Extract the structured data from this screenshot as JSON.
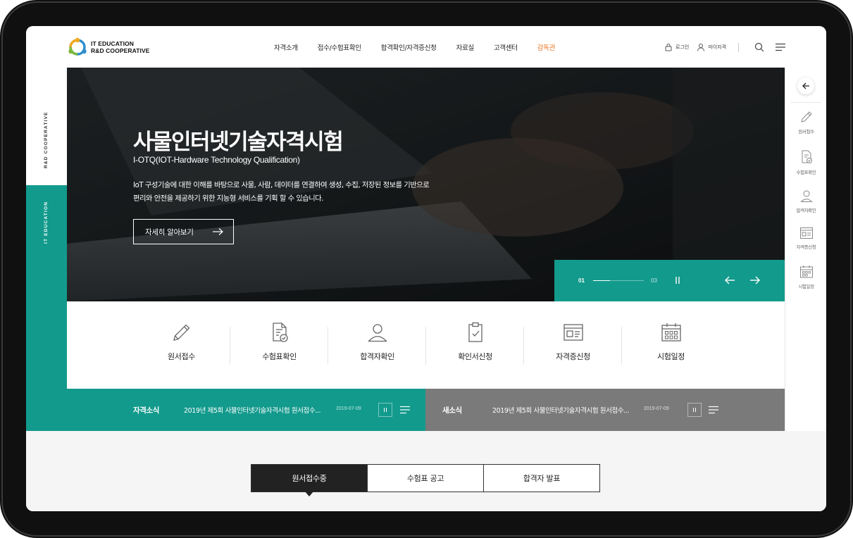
{
  "brand": {
    "line1": "IT EDUCATION",
    "line2": "R&D COOPERATIVE",
    "colors": {
      "teal": "#129a8c",
      "orange": "#e8741e",
      "gray": "#7a7a7a",
      "dark": "#222222"
    }
  },
  "nav": {
    "items": [
      {
        "label": "자격소개",
        "active": false
      },
      {
        "label": "접수/수험표확인",
        "active": false
      },
      {
        "label": "합격확인/자격증신청",
        "active": false
      },
      {
        "label": "자료실",
        "active": false
      },
      {
        "label": "고객센터",
        "active": false
      },
      {
        "label": "감독관",
        "active": true
      }
    ],
    "login": "로그인",
    "mypage": "마이자격",
    "search_icon": "search-icon",
    "menu_icon": "hamburger-menu-icon"
  },
  "rail": {
    "top_label": "R&D COOPERATIVE",
    "bottom_label": "IT EDUCATION"
  },
  "hero": {
    "title": "사물인터넷기술자격시험",
    "subtitle": "I-OTQ(IOT-Hardware Technology Qualification)",
    "desc_line1": "IoT 구성기술에 대한 이해를 바탕으로 사물, 사람, 데이터를 연결하여 생성, 수집, 저장된 정보를 기반으로",
    "desc_line2": "편리와 안전을 제공하기 위한 지능형 서비스를 기획 할 수 있습니다.",
    "button": "자세히 알아보기",
    "slide_current": "01",
    "slide_total": "03",
    "slide_progress": 0.33
  },
  "quick_menu": {
    "items": [
      {
        "label": "원서접수",
        "icon": "pencil-icon"
      },
      {
        "label": "수험표확인",
        "icon": "document-check-icon"
      },
      {
        "label": "합격자확인",
        "icon": "person-icon"
      },
      {
        "label": "자격증신청",
        "icon": "certificate-icon"
      },
      {
        "label": "시험일정",
        "icon": "calendar-icon"
      }
    ]
  },
  "services": [
    {
      "label": "원서접수",
      "icon": "pencil-icon"
    },
    {
      "label": "수험표확인",
      "icon": "document-check-icon"
    },
    {
      "label": "합격자확인",
      "icon": "person-icon"
    },
    {
      "label": "확인서신청",
      "icon": "clipboard-check-icon"
    },
    {
      "label": "자격증신청",
      "icon": "certificate-icon"
    },
    {
      "label": "시험일정",
      "icon": "calendar-icon"
    }
  ],
  "news": {
    "cert": {
      "title": "자격소식",
      "text": "2019년 제5회 사물인터넷기술자격시험 원서접수...",
      "date": "2019-07-09"
    },
    "general": {
      "title": "새소식",
      "text": "2019년 제5회 사물인터넷기술자격시험 원서접수...",
      "date": "2019-07-09"
    }
  },
  "tabs": [
    {
      "label": "원서접수중",
      "active": true
    },
    {
      "label": "수험표 공고",
      "active": false
    },
    {
      "label": "합격자 발표",
      "active": false
    }
  ]
}
